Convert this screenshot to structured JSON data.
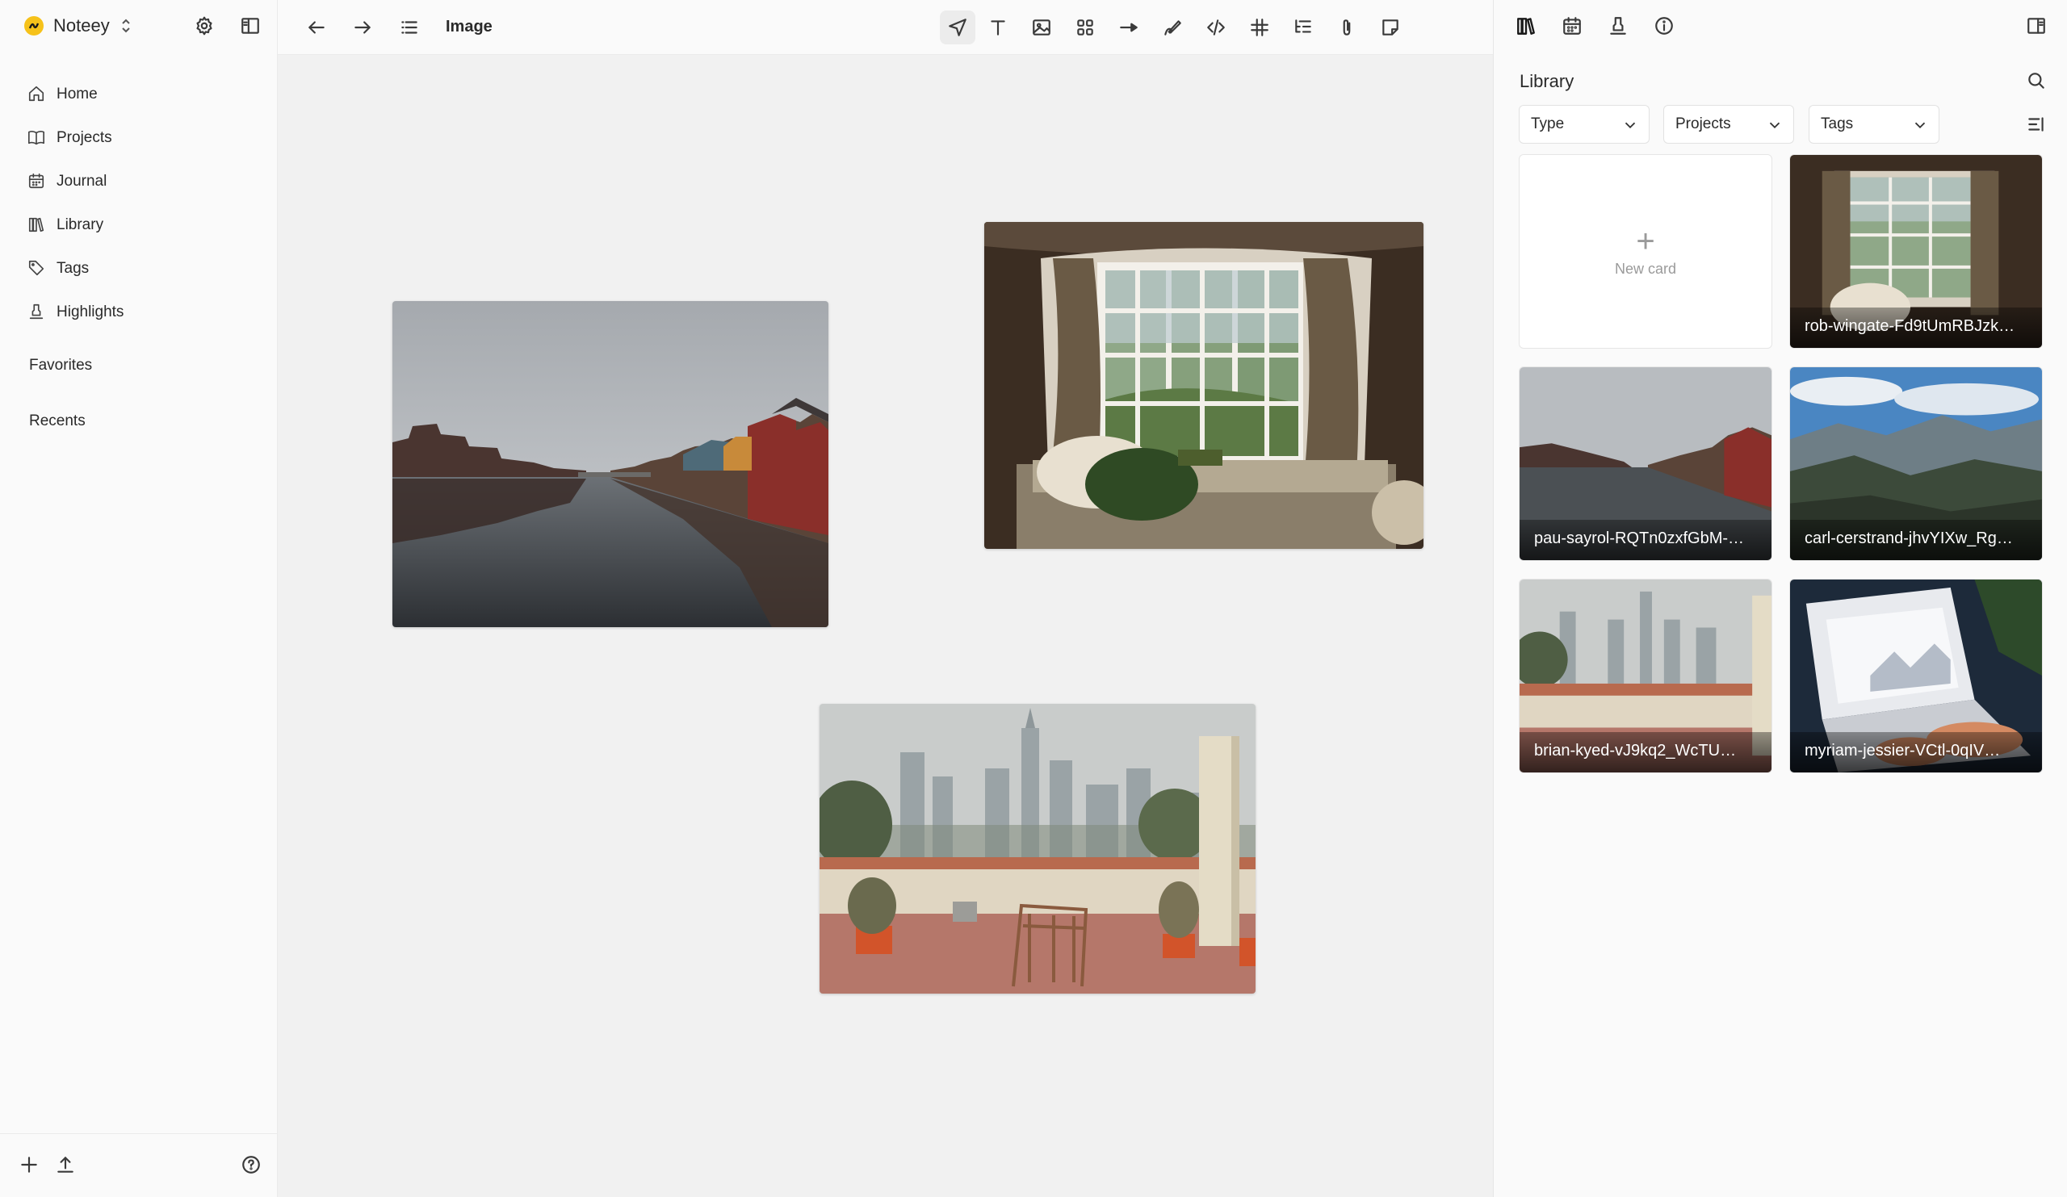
{
  "app": {
    "name": "Noteey"
  },
  "sidebar": {
    "nav": [
      {
        "label": "Home",
        "icon": "home-icon"
      },
      {
        "label": "Projects",
        "icon": "book-icon"
      },
      {
        "label": "Journal",
        "icon": "calendar-icon"
      },
      {
        "label": "Library",
        "icon": "library-icon"
      },
      {
        "label": "Tags",
        "icon": "tag-icon"
      },
      {
        "label": "Highlights",
        "icon": "highlighter-icon"
      }
    ],
    "favorites_label": "Favorites",
    "recents_label": "Recents"
  },
  "toolbar": {
    "title": "Image",
    "tools": [
      "select-tool-icon",
      "text-tool-icon",
      "image-tool-icon",
      "group-tool-icon",
      "arrow-tool-icon",
      "pen-tool-icon",
      "code-tool-icon",
      "table-tool-icon",
      "outline-tool-icon",
      "attachment-tool-icon",
      "sticky-note-tool-icon"
    ]
  },
  "library": {
    "title": "Library",
    "filters": [
      "Type",
      "Projects",
      "Tags"
    ],
    "new_card_label": "New card",
    "cards": [
      {
        "label": "rob-wingate-Fd9tUmRBJzk…"
      },
      {
        "label": "pau-sayrol-RQTn0zxfGbM-…"
      },
      {
        "label": "carl-cerstrand-jhvYIXw_Rg…"
      },
      {
        "label": "brian-kyed-vJ9kq2_WcTU…"
      },
      {
        "label": "myriam-jessier-VCtl-0qIV…"
      }
    ]
  },
  "colors": {
    "brand": "#f6c21a",
    "canvas": "#f1f1f1",
    "panel": "#fafafa"
  }
}
